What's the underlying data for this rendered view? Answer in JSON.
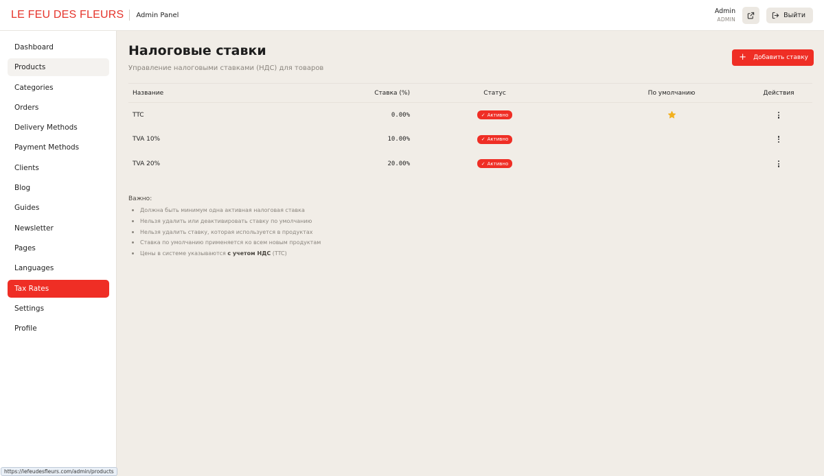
{
  "header": {
    "logo": "LE FEU DES FLEURS",
    "panel_label": "Admin Panel",
    "user_name": "Admin",
    "user_role": "ADMIN",
    "logout_label": "Выйти"
  },
  "sidebar": {
    "items": [
      {
        "label": "Dashboard"
      },
      {
        "label": "Products"
      },
      {
        "label": "Categories"
      },
      {
        "label": "Orders"
      },
      {
        "label": "Delivery Methods"
      },
      {
        "label": "Payment Methods"
      },
      {
        "label": "Clients"
      },
      {
        "label": "Blog"
      },
      {
        "label": "Guides"
      },
      {
        "label": "Newsletter"
      },
      {
        "label": "Pages"
      },
      {
        "label": "Languages"
      },
      {
        "label": "Tax Rates"
      },
      {
        "label": "Settings"
      },
      {
        "label": "Profile"
      }
    ],
    "active_item": "Tax Rates",
    "hovered_item": "Products"
  },
  "main": {
    "title": "Налоговые ставки",
    "subtitle": "Управление налоговыми ставками (НДС) для товаров",
    "add_button": "Добавить ставку",
    "table": {
      "headers": {
        "name": "Название",
        "rate": "Ставка (%)",
        "status": "Статус",
        "default": "По умолчанию",
        "actions": "Действия"
      },
      "rows": [
        {
          "name": "TTC",
          "rate": "0.00%",
          "status": "Активно",
          "is_default": true
        },
        {
          "name": "TVA 10%",
          "rate": "10.00%",
          "status": "Активно",
          "is_default": false
        },
        {
          "name": "TVA 20%",
          "rate": "20.00%",
          "status": "Активно",
          "is_default": false
        }
      ]
    },
    "notes": {
      "title": "Важно:",
      "items": [
        "Должна быть минимум одна активная налоговая ставка",
        "Нельзя удалить или деактивировать ставку по умолчанию",
        "Нельзя удалить ставку, которая используется в продуктах",
        "Ставка по умолчанию применяется ко всем новым продуктам"
      ],
      "last_item_prefix": "Цены в системе указываются ",
      "last_item_bold": "с учетом НДС",
      "last_item_suffix": " (TTC)"
    }
  },
  "status_bar": {
    "url": "https://lefeudesfleurs.com/admin/products"
  },
  "colors": {
    "accent": "#ef2e25",
    "logo": "#e5332a",
    "star": "#f2b01e",
    "background": "#f1ede7"
  },
  "icons": {
    "external_link": "external-link-icon",
    "logout": "logout-icon",
    "plus": "plus-icon",
    "check": "check-icon",
    "star": "star-icon",
    "more": "more-vertical-icon"
  }
}
